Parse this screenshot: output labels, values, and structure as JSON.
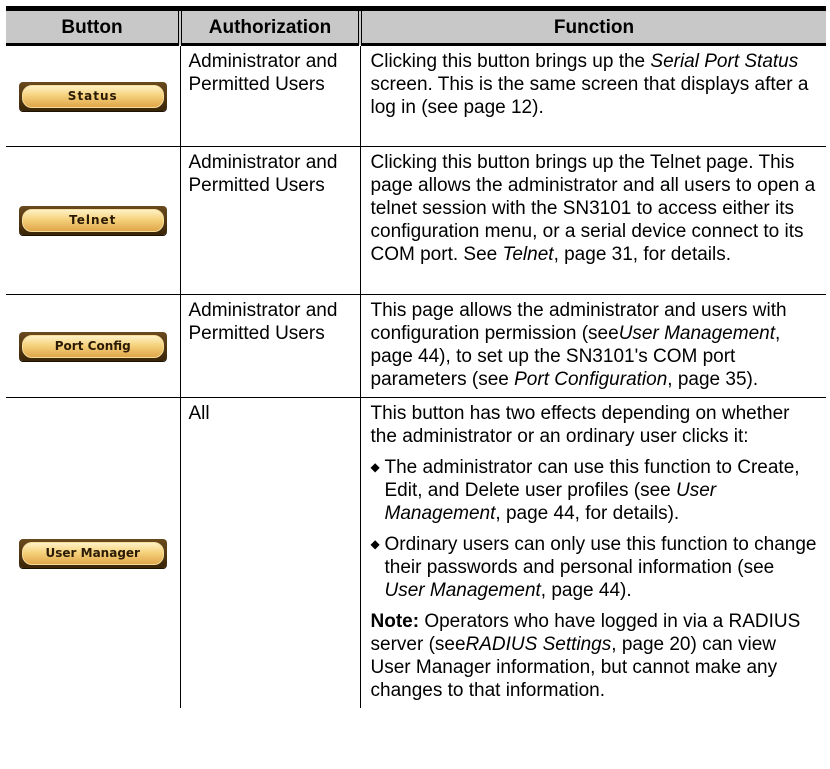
{
  "header": {
    "col_button": "Button",
    "col_authorization": "Authorization",
    "col_function": "Function"
  },
  "rows": [
    {
      "button_label": "Status",
      "authorization": "Administrator and Permitted Users",
      "function": {
        "p1_a": "Clicking this button brings up the ",
        "p1_i": "Serial Port Status",
        "p1_b": " screen. This is the same screen that displays after a log in (see page 12)."
      }
    },
    {
      "button_label": "Telnet",
      "authorization": "Administrator and Permitted Users",
      "function": {
        "p1_a": "Clicking this button brings up the Telnet page. This page allows the administrator and all users to open a telnet session with the SN3101 to access either its configuration menu, or a serial device connect to its COM port. See ",
        "p1_i": "Telnet",
        "p1_b": ", page 31, for details."
      }
    },
    {
      "button_label": "Port Config",
      "authorization": "Administrator and Permitted Users",
      "function": {
        "p1_a": "This page allows the administrator and users with configuration permission (see",
        "p1_i": "User Management",
        "p1_b": ", page 44), to set up the SN3101's COM port parameters (see ",
        "p1_i2": "Port Configuration",
        "p1_c": ", page 35)."
      }
    },
    {
      "button_label": "User Manager",
      "authorization": "All",
      "function": {
        "intro": "This button has two effects depending on whether the administrator or an ordinary user clicks it:",
        "bullet1_a": "The administrator can use this function to Create, Edit, and Delete user profiles (see ",
        "bullet1_i": "User Management",
        "bullet1_b": ", page 44, for details).",
        "bullet2_a": "Ordinary users can only use this function to change their passwords and personal information (see ",
        "bullet2_i": "User Management",
        "bullet2_b": ", page 44).",
        "note_label": "Note:",
        "note_a": " Operators who have logged in via a RADIUS server (see",
        "note_i": "RADIUS Settings",
        "note_b": ", page 20) can view User Manager information, but cannot make any changes to that information."
      }
    }
  ],
  "colors": {
    "header_bg": "#c8c8c8",
    "button_face": "#f5d27c",
    "button_border": "#4a300d"
  }
}
